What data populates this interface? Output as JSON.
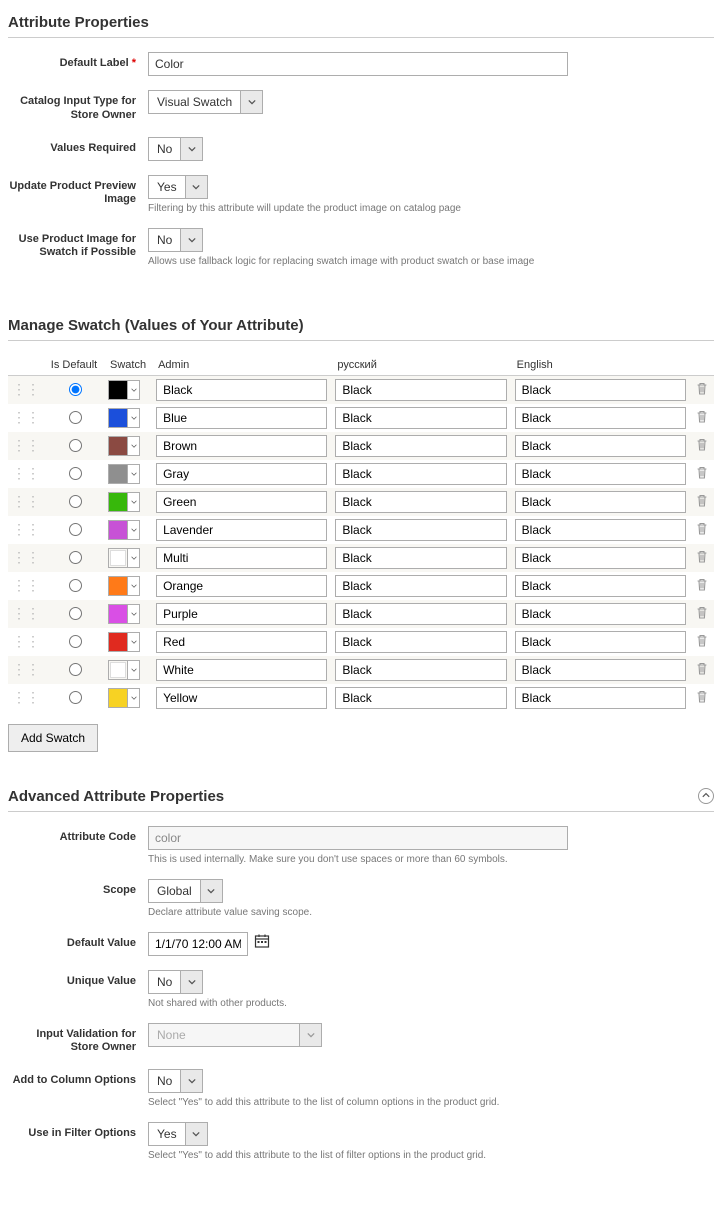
{
  "sections": {
    "attrProps": "Attribute Properties",
    "manageSwatch": "Manage Swatch (Values of Your Attribute)",
    "advanced": "Advanced Attribute Properties"
  },
  "labels": {
    "defaultLabel": "Default Label",
    "catalogInputType": "Catalog Input Type for Store Owner",
    "valuesRequired": "Values Required",
    "updatePreview": "Update Product Preview Image",
    "useProductImage": "Use Product Image for Swatch if Possible",
    "attributeCode": "Attribute Code",
    "scope": "Scope",
    "defaultValue": "Default Value",
    "uniqueValue": "Unique Value",
    "inputValidation": "Input Validation for Store Owner",
    "addColumn": "Add to Column Options",
    "useFilter": "Use in Filter Options"
  },
  "values": {
    "defaultLabel": "Color",
    "catalogInputType": "Visual Swatch",
    "valuesRequired": "No",
    "updatePreview": "Yes",
    "useProductImage": "No",
    "attributeCode": "color",
    "scope": "Global",
    "defaultValue": "1/1/70 12:00 AM",
    "uniqueValue": "No",
    "inputValidation": "None",
    "addColumn": "No",
    "useFilter": "Yes"
  },
  "hints": {
    "updatePreview": "Filtering by this attribute will update the product image on catalog page",
    "useProductImage": "Allows use fallback logic for replacing swatch image with product swatch or base image",
    "attributeCode": "This is used internally. Make sure you don't use spaces or more than 60 symbols.",
    "scope": "Declare attribute value saving scope.",
    "uniqueValue": "Not shared with other products.",
    "addColumn": "Select \"Yes\" to add this attribute to the list of column options in the product grid.",
    "useFilter": "Select \"Yes\" to add this attribute to the list of filter options in the product grid."
  },
  "swatchHeaders": {
    "isDefault": "Is Default",
    "swatch": "Swatch",
    "admin": "Admin",
    "ru": "русский",
    "en": "English"
  },
  "swatches": [
    {
      "color": "#000000",
      "dot": true,
      "admin": "Black",
      "ru": "Black",
      "en": "Black",
      "white": false
    },
    {
      "color": "#1b4fdb",
      "dot": false,
      "admin": "Blue",
      "ru": "Black",
      "en": "Black",
      "white": false
    },
    {
      "color": "#8b4a42",
      "dot": false,
      "admin": "Brown",
      "ru": "Black",
      "en": "Black",
      "white": false
    },
    {
      "color": "#8f8f8f",
      "dot": false,
      "admin": "Gray",
      "ru": "Black",
      "en": "Black",
      "white": false
    },
    {
      "color": "#37b80b",
      "dot": false,
      "admin": "Green",
      "ru": "Black",
      "en": "Black",
      "white": false
    },
    {
      "color": "#c752d6",
      "dot": false,
      "admin": "Lavender",
      "ru": "Black",
      "en": "Black",
      "white": false
    },
    {
      "color": "#ffffff",
      "dot": false,
      "admin": "Multi",
      "ru": "Black",
      "en": "Black",
      "white": true
    },
    {
      "color": "#ff7a18",
      "dot": false,
      "admin": "Orange",
      "ru": "Black",
      "en": "Black",
      "white": false
    },
    {
      "color": "#d94fe5",
      "dot": false,
      "admin": "Purple",
      "ru": "Black",
      "en": "Black",
      "white": false
    },
    {
      "color": "#e02a1f",
      "dot": false,
      "admin": "Red",
      "ru": "Black",
      "en": "Black",
      "white": false
    },
    {
      "color": "#ffffff",
      "dot": false,
      "admin": "White",
      "ru": "Black",
      "en": "Black",
      "white": true
    },
    {
      "color": "#f7d223",
      "dot": false,
      "admin": "Yellow",
      "ru": "Black",
      "en": "Black",
      "white": false
    }
  ],
  "addSwatch": "Add Swatch"
}
